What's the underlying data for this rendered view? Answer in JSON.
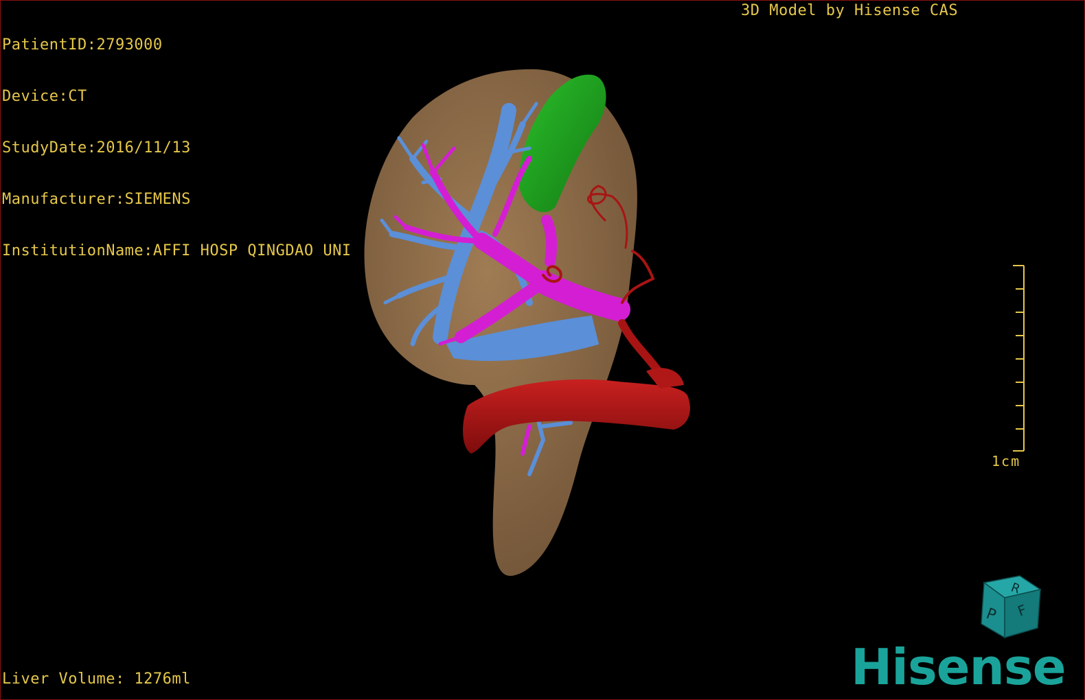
{
  "overlay": {
    "patient_id": "PatientID:2793000",
    "device": "Device:CT",
    "study_date": "StudyDate:2016/11/13",
    "manufacturer": "Manufacturer:SIEMENS",
    "institution": "InstitutionName:AFFI HOSP QINGDAO UNI",
    "credit": "3D Model by Hisense CAS",
    "volume": "Liver Volume: 1276ml"
  },
  "scale": {
    "label": "1cm",
    "color": "#e6c84a"
  },
  "orientation_cube": {
    "faces": [
      "R",
      "F",
      "P"
    ],
    "color": "#1b8f8f"
  },
  "logo": {
    "text": "Hisense",
    "color": "#1aa39a"
  },
  "model": {
    "structures": [
      {
        "name": "liver",
        "color": "#8a6a48"
      },
      {
        "name": "gallbladder",
        "color": "#1f9a1f"
      },
      {
        "name": "hepatic-veins",
        "color": "#5b8fd8"
      },
      {
        "name": "portal-vein",
        "color": "#d41ed4"
      },
      {
        "name": "artery",
        "color": "#b01818"
      }
    ]
  },
  "colors": {
    "text": "#e6c84a",
    "border": "#8a1010",
    "background": "#000000"
  }
}
